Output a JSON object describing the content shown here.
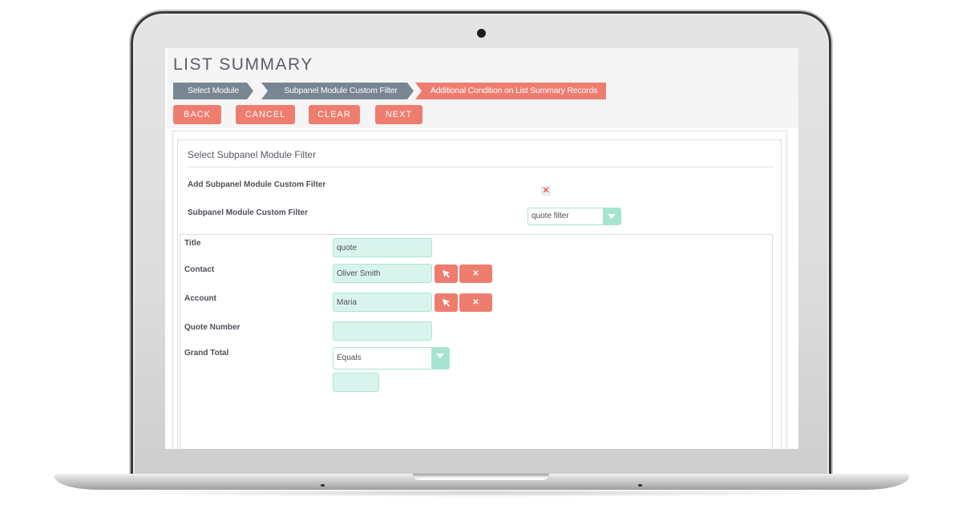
{
  "page": {
    "title": "LIST SUMMARY"
  },
  "wizard_steps": [
    {
      "label": "Select Module",
      "state": "done"
    },
    {
      "label": "Subpanel Module Custom Filter",
      "state": "done"
    },
    {
      "label": "Additional Condition on List Summary Records",
      "state": "active"
    }
  ],
  "actions": {
    "back": "BACK",
    "cancel": "CANCEL",
    "clear": "CLEAR",
    "next": "NEXT"
  },
  "section": {
    "title": "Select Subpanel Module Filter",
    "add_filter_label": "Add Subpanel Module Custom Filter",
    "add_filter_checked": true,
    "add_filter_mark": "✕",
    "custom_filter_label": "Subpanel Module Custom Filter",
    "custom_filter_value": "quote filter"
  },
  "filter_fields": {
    "title": {
      "label": "Title",
      "value": "quote"
    },
    "contact": {
      "label": "Contact",
      "value": "Oliver Smith",
      "clear_glyph": "✕"
    },
    "account": {
      "label": "Account",
      "value": "Maria",
      "clear_glyph": "✕"
    },
    "quote_number": {
      "label": "Quote Number",
      "value": ""
    },
    "grand_total": {
      "label": "Grand Total",
      "operator": "Equals",
      "value": ""
    }
  },
  "colors": {
    "accent": "#ee7d70",
    "step_done": "#778692",
    "input_bg": "#d8f4ec",
    "input_border": "#a9e6d4"
  }
}
